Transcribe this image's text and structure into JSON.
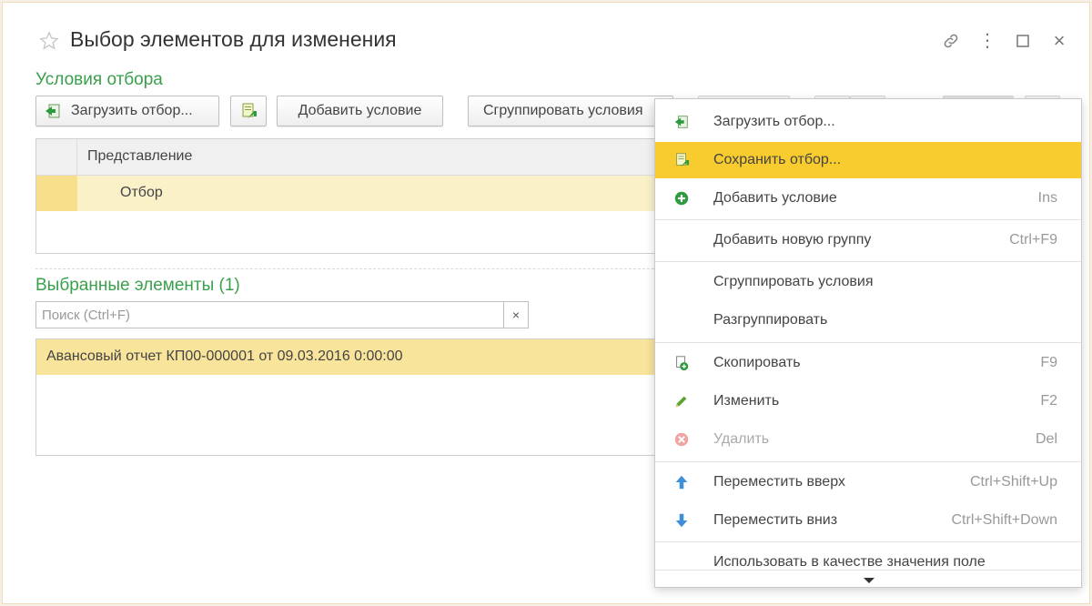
{
  "window": {
    "title": "Выбор элементов для изменения",
    "close_glyph": "×",
    "more_glyph": "⋮"
  },
  "conditions": {
    "section_title": "Условия отбора",
    "toolbar": {
      "load_label": "Загрузить отбор...",
      "add_condition_label": "Добавить условие",
      "group_conditions_label": "Сгруппировать условия"
    },
    "table": {
      "header": "Представление",
      "rows": [
        {
          "label": "Отбор"
        }
      ]
    }
  },
  "selected": {
    "section_title": "Выбранные элементы (1)",
    "search": {
      "placeholder": "Поиск (Ctrl+F)",
      "value": "",
      "clear_glyph": "×"
    },
    "rows": [
      {
        "label": "Авансовый отчет КП00-000001 от 09.03.2016 0:00:00"
      }
    ]
  },
  "context_menu": {
    "items": [
      {
        "label": "Загрузить отбор...",
        "key": "",
        "icon": "load-filter-icon"
      },
      {
        "label": "Сохранить отбор...",
        "key": "",
        "icon": "save-filter-icon"
      },
      {
        "label": "Добавить условие",
        "key": "Ins",
        "icon": "add-circle-icon"
      },
      {
        "label": "Добавить новую группу",
        "key": "Ctrl+F9",
        "icon": ""
      },
      {
        "label": "Сгруппировать условия",
        "key": "",
        "icon": ""
      },
      {
        "label": "Разгруппировать",
        "key": "",
        "icon": ""
      },
      {
        "label": "Скопировать",
        "key": "F9",
        "icon": "copy-icon"
      },
      {
        "label": "Изменить",
        "key": "F2",
        "icon": "pencil-icon"
      },
      {
        "label": "Удалить",
        "key": "Del",
        "icon": "delete-icon"
      },
      {
        "label": "Переместить вверх",
        "key": "Ctrl+Shift+Up",
        "icon": "arrow-up-icon"
      },
      {
        "label": "Переместить вниз",
        "key": "Ctrl+Shift+Down",
        "icon": "arrow-down-icon"
      },
      {
        "label": "Использовать в качестве значения поле",
        "key": "",
        "icon": ""
      }
    ],
    "highlighted_index": 1,
    "disabled_index": 8
  },
  "colors": {
    "accent_green": "#3aa04b",
    "highlight_yellow": "#f8cb2e",
    "row_selected": "#f9e49c"
  }
}
